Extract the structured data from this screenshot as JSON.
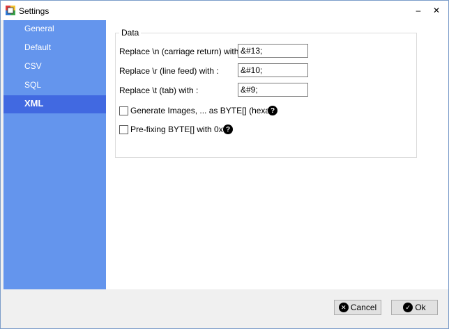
{
  "window": {
    "title": "Settings",
    "minimize_glyph": "–",
    "close_glyph": "✕"
  },
  "sidebar": {
    "items": [
      {
        "label": "General",
        "active": false
      },
      {
        "label": "Default",
        "active": false
      },
      {
        "label": "CSV",
        "active": false
      },
      {
        "label": "SQL",
        "active": false
      },
      {
        "label": "XML",
        "active": true
      }
    ]
  },
  "data_group": {
    "legend": "Data",
    "replace_n": {
      "label": "Replace \\n (carriage return) with :",
      "value": "&#13;"
    },
    "replace_r": {
      "label": "Replace \\r (line feed) with :",
      "value": "&#10;"
    },
    "replace_t": {
      "label": "Replace \\t (tab) with :",
      "value": "&#9;"
    },
    "generate_images": {
      "label": "Generate Images, ... as BYTE[] (hexa)",
      "checked": false
    },
    "prefix_bytes": {
      "label": "Pre-fixing BYTE[] with 0x",
      "checked": false
    },
    "help_glyph": "?"
  },
  "footer": {
    "cancel_label": "Cancel",
    "ok_label": "Ok"
  },
  "colors": {
    "sidebar_bg": "#6495ED",
    "sidebar_active_bg": "#4169E1",
    "sidebar_text": "#FFFFFF"
  },
  "icons": {
    "app": "settings-app-icon",
    "cancel": "cancel-x-circle-icon",
    "ok": "ok-check-circle-icon",
    "help": "help-question-icon"
  }
}
